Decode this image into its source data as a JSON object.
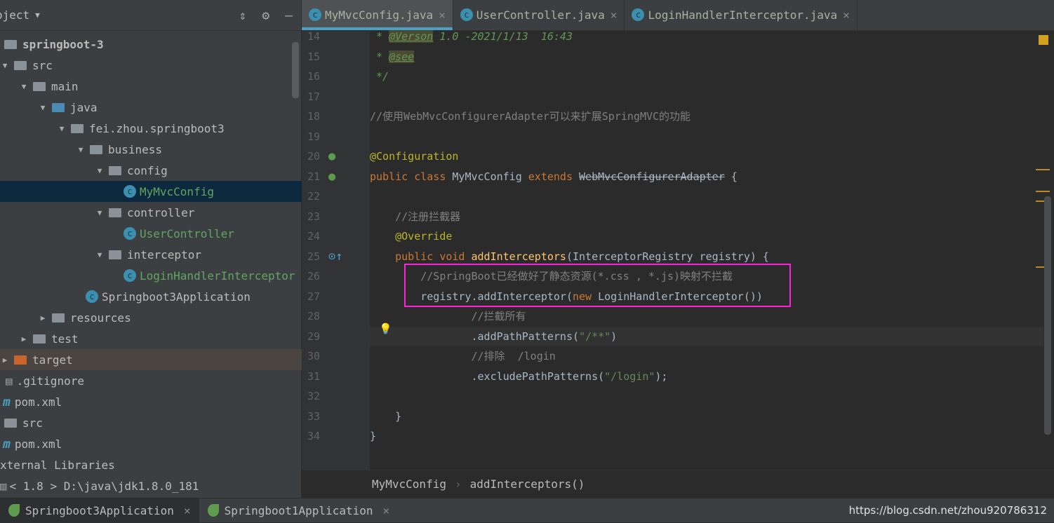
{
  "sidebar": {
    "title": "oject",
    "tree": [
      {
        "label": "springboot-3",
        "level": 0,
        "arrow": "",
        "icon": "module",
        "bold": true
      },
      {
        "label": "src",
        "level": 0,
        "arrow": "▼",
        "icon": "folder"
      },
      {
        "label": "main",
        "level": 1,
        "arrow": "▼",
        "icon": "folder"
      },
      {
        "label": "java",
        "level": 2,
        "arrow": "▼",
        "icon": "folder-blue"
      },
      {
        "label": "fei.zhou.springboot3",
        "level": 3,
        "arrow": "▼",
        "icon": "package"
      },
      {
        "label": "business",
        "level": 4,
        "arrow": "▼",
        "icon": "package"
      },
      {
        "label": "config",
        "level": 5,
        "arrow": "▼",
        "icon": "package"
      },
      {
        "label": "MyMvcConfig",
        "level": 6,
        "arrow": "",
        "icon": "class",
        "selected": true
      },
      {
        "label": "controller",
        "level": 5,
        "arrow": "▼",
        "icon": "package"
      },
      {
        "label": "UserController",
        "level": 6,
        "arrow": "",
        "icon": "class"
      },
      {
        "label": "interceptor",
        "level": 5,
        "arrow": "▼",
        "icon": "package"
      },
      {
        "label": "LoginHandlerInterceptor",
        "level": 6,
        "arrow": "",
        "icon": "class"
      },
      {
        "label": "Springboot3Application",
        "level": 4,
        "arrow": "",
        "icon": "class"
      },
      {
        "label": "resources",
        "level": 2,
        "arrow": "▶",
        "icon": "folder"
      },
      {
        "label": "test",
        "level": 1,
        "arrow": "▶",
        "icon": "folder"
      },
      {
        "label": "target",
        "level": 0,
        "arrow": "▶",
        "icon": "folder-orange",
        "excluded": true
      },
      {
        "label": ".gitignore",
        "level": 0,
        "arrow": "",
        "icon": "file"
      },
      {
        "label": "pom.xml",
        "level": 0,
        "arrow": "",
        "icon": "maven"
      },
      {
        "label": "src",
        "level": -1,
        "arrow": "",
        "icon": "folder"
      },
      {
        "label": "pom.xml",
        "level": -1,
        "arrow": "",
        "icon": "maven"
      },
      {
        "label": "xternal Libraries",
        "level": -1,
        "arrow": "",
        "icon": ""
      },
      {
        "label": "< 1.8 >  D:\\java\\jdk1.8.0_181",
        "level": -1,
        "arrow": "",
        "icon": "jdk"
      }
    ]
  },
  "tabs": [
    {
      "label": "MyMvcConfig.java",
      "active": true
    },
    {
      "label": "UserController.java"
    },
    {
      "label": "LoginHandlerInterceptor.java"
    }
  ],
  "code": [
    {
      "n": "14",
      "t": [
        [
          "doc",
          " * "
        ],
        [
          "tag",
          "@Verson"
        ],
        [
          "doc",
          " 1.0 -2021/1/13  16:43"
        ]
      ]
    },
    {
      "n": "15",
      "t": [
        [
          "doc",
          " * "
        ],
        [
          "tag",
          "@see"
        ]
      ]
    },
    {
      "n": "16",
      "t": [
        [
          "doc",
          " */"
        ]
      ]
    },
    {
      "n": "17",
      "t": []
    },
    {
      "n": "18",
      "t": [
        [
          "cm",
          "//使用WebMvcConfigurerAdapter可以来扩展SpringMVC的功能"
        ]
      ]
    },
    {
      "n": "19",
      "t": []
    },
    {
      "n": "20",
      "t": [
        [
          "an",
          "@Configuration"
        ]
      ]
    },
    {
      "n": "21",
      "t": [
        [
          "kw",
          "public class "
        ],
        [
          "df",
          "MyMvcConfig "
        ],
        [
          "kw",
          "extends "
        ],
        [
          "strike",
          "WebMvcConfigurerAdapter"
        ],
        [
          "df",
          " {"
        ]
      ]
    },
    {
      "n": "22",
      "t": []
    },
    {
      "n": "23",
      "t": [
        [
          "cm",
          "    //注册拦截器"
        ]
      ]
    },
    {
      "n": "24",
      "t": [
        [
          "an",
          "    @Override"
        ]
      ]
    },
    {
      "n": "25",
      "t": [
        [
          "kw",
          "    public void "
        ],
        [
          "md",
          "addInterceptors"
        ],
        [
          "df",
          "(InterceptorRegistry registry) {"
        ]
      ]
    },
    {
      "n": "26",
      "t": [
        [
          "cm",
          "        //SpringBoot已经做好了静态资源(*.css , *.js)映射不拦截"
        ]
      ]
    },
    {
      "n": "27",
      "t": [
        [
          "df",
          "        registry.addInterceptor("
        ],
        [
          "kw",
          "new "
        ],
        [
          "df",
          "LoginHandlerInterceptor())"
        ]
      ]
    },
    {
      "n": "28",
      "t": [
        [
          "cm",
          "                //拦截所有"
        ]
      ]
    },
    {
      "n": "29",
      "t": [
        [
          "df",
          "                .addPathPatterns("
        ],
        [
          "st",
          "\"/**\""
        ],
        [
          "df",
          ")"
        ]
      ]
    },
    {
      "n": "30",
      "t": [
        [
          "cm",
          "                //排除  /login"
        ]
      ]
    },
    {
      "n": "31",
      "t": [
        [
          "df",
          "                .excludePathPatterns("
        ],
        [
          "st",
          "\"/login\""
        ],
        [
          "df",
          ");"
        ]
      ]
    },
    {
      "n": "32",
      "t": []
    },
    {
      "n": "33",
      "t": [
        [
          "df",
          "    }"
        ]
      ]
    },
    {
      "n": "34",
      "t": [
        [
          "df",
          "}"
        ]
      ]
    }
  ],
  "breadcrumb": [
    "MyMvcConfig",
    "addInterceptors()"
  ],
  "run_tabs": [
    {
      "label": "Springboot3Application",
      "active": true
    },
    {
      "label": "Springboot1Application"
    }
  ],
  "watermark": "https://blog.csdn.net/zhou920786312",
  "colors": {
    "highlight_box": "#ff22dd",
    "accent": "#4a9fc2"
  }
}
